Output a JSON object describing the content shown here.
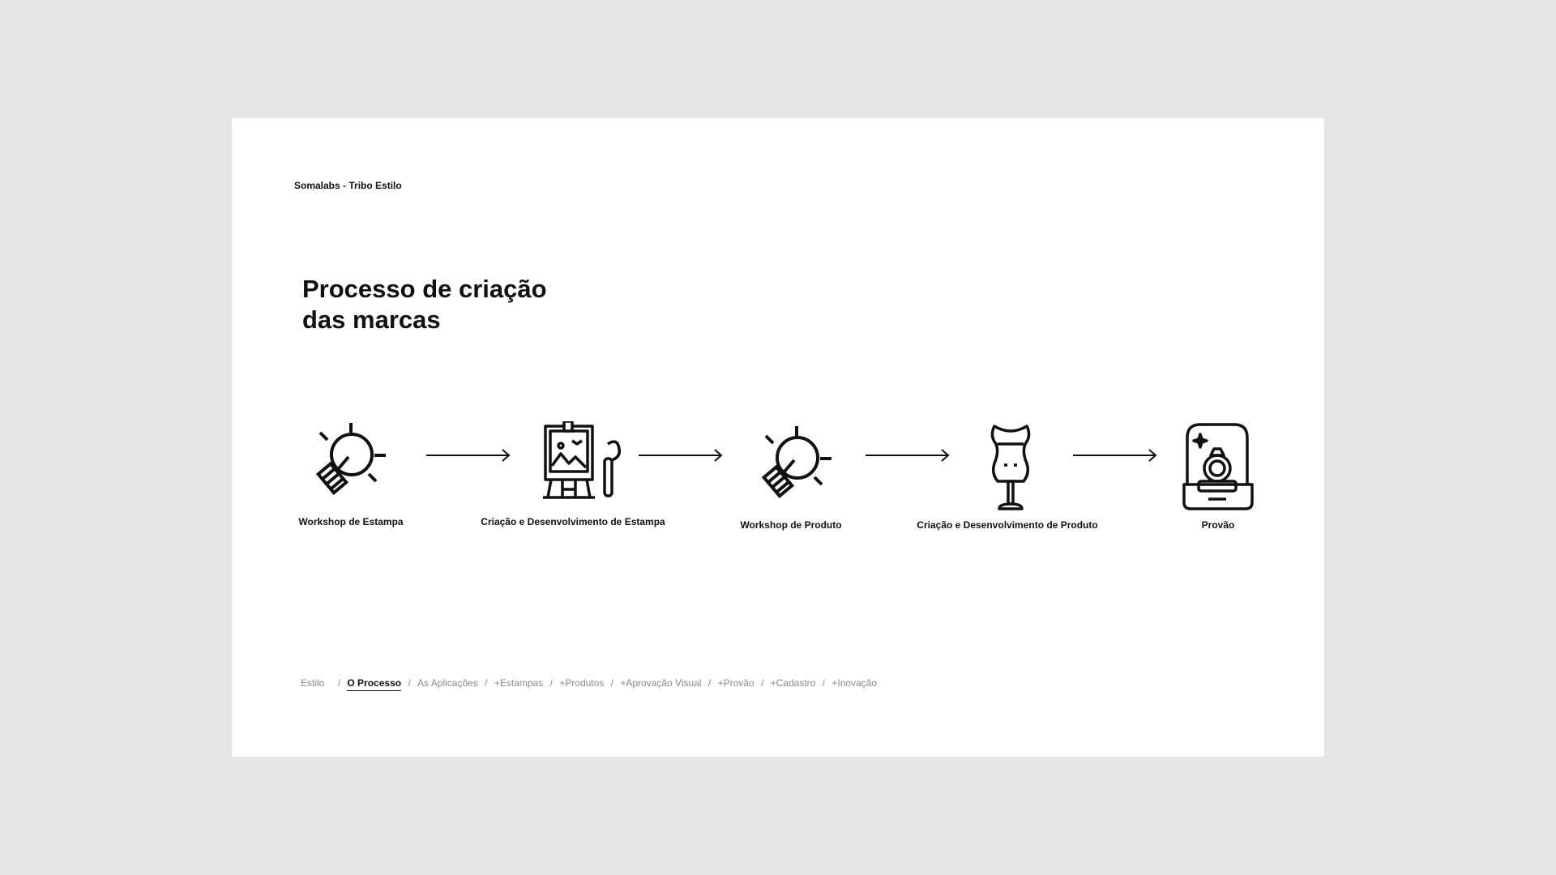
{
  "header": {
    "brand": "Somalabs - Tribo Estilo"
  },
  "title": {
    "line1": "Processo de criação",
    "line2": "das marcas"
  },
  "process_steps": [
    {
      "label": "Workshop de Estampa",
      "icon": "light-bulb-icon"
    },
    {
      "label": "Criação e Desenvolvimento de Estampa",
      "icon": "easel-painting-icon"
    },
    {
      "label": "Workshop de Produto",
      "icon": "light-bulb-icon"
    },
    {
      "label": "Criação e Desenvolvimento de Produto",
      "icon": "mannequin-icon"
    },
    {
      "label": "Provão",
      "icon": "ring-box-icon"
    }
  ],
  "nav": {
    "separator": "/",
    "items": [
      {
        "label": "Estilo",
        "active": false
      },
      {
        "label": "O Processo",
        "active": true
      },
      {
        "label": "As Aplicações",
        "active": false
      },
      {
        "label": "+Estampas",
        "active": false
      },
      {
        "label": "+Produtos",
        "active": false
      },
      {
        "label": "+Aprovação Visual",
        "active": false
      },
      {
        "label": "+Provão",
        "active": false
      },
      {
        "label": "+Cadastro",
        "active": false
      },
      {
        "label": "+Inovação",
        "active": false
      }
    ]
  },
  "colors": {
    "background": "#e5e5e5",
    "slide": "#ffffff",
    "text": "#111111",
    "nav_inactive": "#8a8a8a"
  }
}
